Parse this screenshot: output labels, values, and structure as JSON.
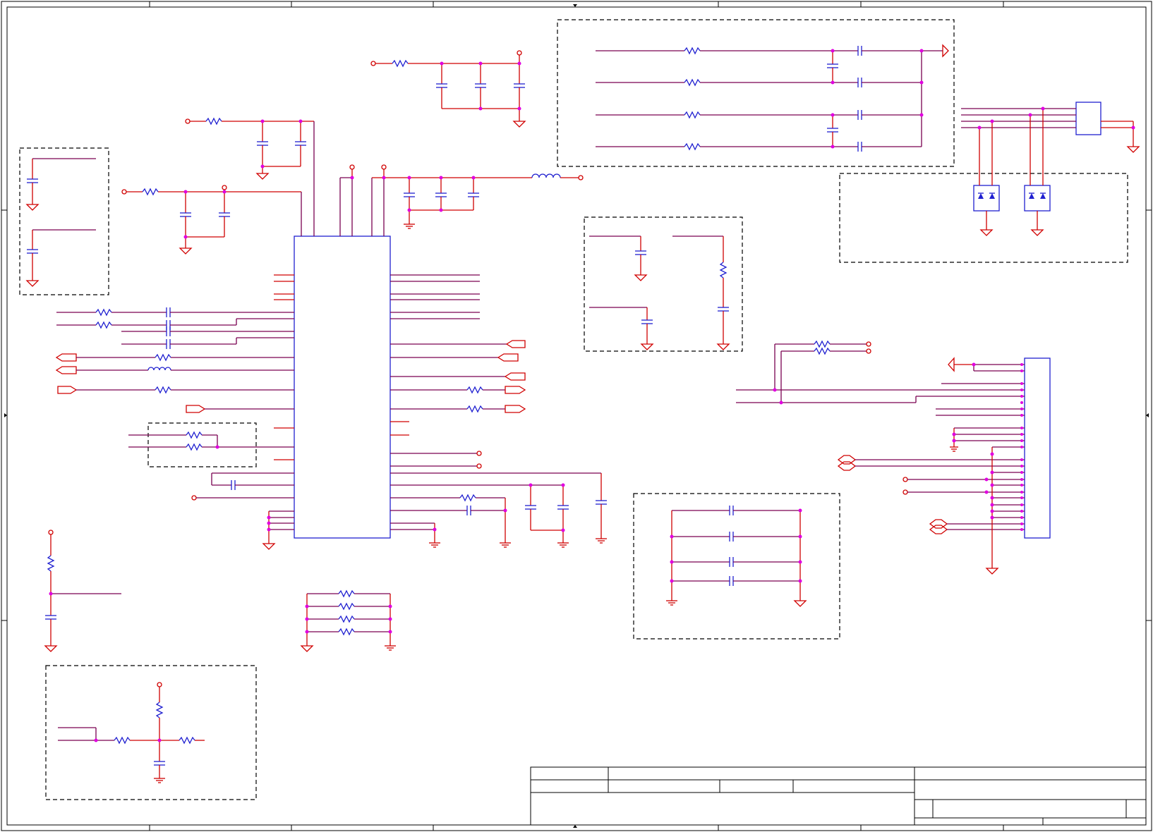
{
  "diagram": {
    "type": "electronic-schematic",
    "has_visible_text": false,
    "colors": {
      "wire": "#d00000",
      "component": "#2020d0",
      "net": "#7a0050",
      "junction": "#e000e0",
      "frame": "#000000"
    }
  }
}
